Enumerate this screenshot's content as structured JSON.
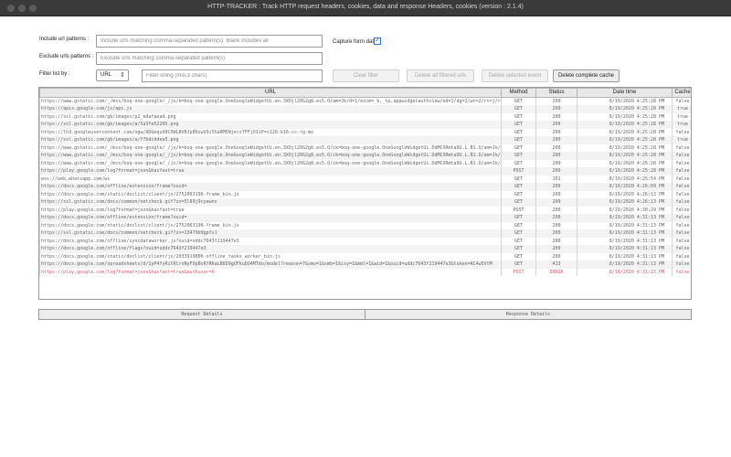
{
  "window": {
    "title": "HTTP-TRACKER : Track HTTP request headers, cookies, data and response Headers, cookies (version : 2.1.4)"
  },
  "form": {
    "include_label": "Include url patterns :",
    "include_placeholder": "Include urls matching comma-separated pattern(s). Blank includes all",
    "exclude_label": "Exclude urls patterns :",
    "exclude_placeholder": "Exclude urls matching comma-separated pattern(s)",
    "capture_label": "Capture form data",
    "capture_checked": true,
    "filter_label": "Filter list by :",
    "filter_select": "URL",
    "filter_placeholder": "Filter string (min 3 chars)"
  },
  "buttons": {
    "clear_filter": "Clear filter",
    "delete_filtered": "Delete all filtered urls",
    "delete_selected": "Delete selected event",
    "delete_cache": "Delete complete cache"
  },
  "table": {
    "columns": [
      "URL",
      "Method",
      "Status",
      "Date time",
      "Cache"
    ],
    "rows": [
      {
        "url": "https://www.gstatic.com/_/mss/boq-one-google/_/js/k=boq-one-google.OneGoogleWidgetUi.en.3X0jl20G2g8.es5.O/am=Jk/d=1/excm=_b,_tp,appwidgetauthview/ed=1/dg=2/wt=2/rt=j/rs=AM-SdHu",
        "method": "GET",
        "status": "200",
        "date": "8/19/2020 4:25:28 PM",
        "cache": "false"
      },
      {
        "url": "https://apis.google.com/js/api.js",
        "method": "GET",
        "status": "200",
        "date": "8/19/2020 4:25:28 PM",
        "cache": "true"
      },
      {
        "url": "https://ssl.gstatic.com/gb/images/p2_edafaead.png",
        "method": "GET",
        "status": "200",
        "date": "8/19/2020 4:25:28 PM",
        "cache": "true"
      },
      {
        "url": "https://ssl.gstatic.com/gb/images/a/5a3fe52205.png",
        "method": "GET",
        "status": "200",
        "date": "8/19/2020 4:25:28 PM",
        "cache": "true"
      },
      {
        "url": "https://lh3.googleusercontent.com/ogw/ADGmqu90COWLBVBJpB0zwV9i5GaRM5Njerz7FFjOIiP=s128-b16-cc-rg-mo",
        "method": "GET",
        "status": "200",
        "date": "8/19/2020 4:25:28 PM",
        "cache": "false"
      },
      {
        "url": "https://ssl.gstatic.com/gb/images/a/f7bdcddea5.png",
        "method": "GET",
        "status": "200",
        "date": "8/19/2020 4:25:28 PM",
        "cache": "true"
      },
      {
        "url": "https://www.gstatic.com/_/mss/boq-one-google/_/js/k=boq-one-google.OneGoogleWidgetUi.en.3X0jl20G2g8.es5.O/ck=boq-one-google.OneGoogleWidgetUi.DdMCXRmta9U.L.B1.O/am=Jk/d=1/e",
        "method": "GET",
        "status": "200",
        "date": "8/19/2020 4:25:28 PM",
        "cache": "false"
      },
      {
        "url": "https://www.gstatic.com/_/mss/boq-one-google/_/js/k=boq-one-google.OneGoogleWidgetUi.en.3X0jl20G2g8.es5.O/ck=boq-one-google.OneGoogleWidgetUi.DdMCXRmta9U.L.B1.O/am=Jk/d=1/e",
        "method": "GET",
        "status": "200",
        "date": "8/19/2020 4:25:28 PM",
        "cache": "false"
      },
      {
        "url": "https://www.gstatic.com/_/mss/boq-one-google/_/js/k=boq-one-google.OneGoogleWidgetUi.en.3X0jl20G2g8.es5.O/ck=boq-one-google.OneGoogleWidgetUi.DdMCXRmta9U.L.B1.O/am=Jk/d=1/e",
        "method": "GET",
        "status": "200",
        "date": "8/19/2020 4:25:28 PM",
        "cache": "false"
      },
      {
        "url": "https://play.google.com/log?format=json&hasfast=true",
        "method": "POST",
        "status": "200",
        "date": "8/19/2020 4:25:28 PM",
        "cache": "false"
      },
      {
        "url": "wss://web.whatsapp.com/ws",
        "method": "GET",
        "status": "101",
        "date": "8/19/2020 4:25:54 PM",
        "cache": "false"
      },
      {
        "url": "https://docs.google.com/offline/extension/frame?ouid=",
        "method": "GET",
        "status": "200",
        "date": "8/19/2020 4:26:09 PM",
        "cache": "false"
      },
      {
        "url": "https://docs.google.com/static/doclist/client/js/2752063196-frame_bin.js",
        "method": "GET",
        "status": "200",
        "date": "8/19/2020 4:26:13 PM",
        "cache": "false"
      },
      {
        "url": "https://ssl.gstatic.com/docs/common/netcheck.gif?zx=5l89j9cyewns",
        "method": "GET",
        "status": "200",
        "date": "8/19/2020 4:26:13 PM",
        "cache": "false"
      },
      {
        "url": "https://play.google.com/log?format=json&hasfast=true",
        "method": "POST",
        "status": "200",
        "date": "8/19/2020 4:30:29 PM",
        "cache": "false"
      },
      {
        "url": "https://docs.google.com/offline/extension/frame?ouid=",
        "method": "GET",
        "status": "200",
        "date": "8/19/2020 4:31:13 PM",
        "cache": "false"
      },
      {
        "url": "https://docs.google.com/static/doclist/client/js/2752063196-frame_bin.js",
        "method": "GET",
        "status": "200",
        "date": "8/19/2020 4:31:13 PM",
        "cache": "false"
      },
      {
        "url": "https://ssl.gstatic.com/docs/common/netcheck.gif?zx=13479b9gpfs1",
        "method": "GET",
        "status": "200",
        "date": "8/19/2020 4:31:13 PM",
        "cache": "false"
      },
      {
        "url": "https://docs.google.com/offline/syncdataworker.js?ouid=uddc7643f219447e3",
        "method": "GET",
        "status": "200",
        "date": "8/19/2020 4:31:13 PM",
        "cache": "false"
      },
      {
        "url": "https://docs.google.com/offline/flags?ouid=uddc7643f219447e3",
        "method": "GET",
        "status": "200",
        "date": "8/19/2020 4:31:13 PM",
        "cache": "false"
      },
      {
        "url": "https://docs.google.com/static/doclist/client/js/2033919806-offline_tasks_worker_bin.js",
        "method": "GET",
        "status": "200",
        "date": "8/19/2020 4:31:13 PM",
        "cache": "false"
      },
      {
        "url": "https://docs.google.com/spreadsheets/d/1yP4fyRitRlrxNyFOpBsRfRKaLB6D9gUFkuDO4MTdo/model?reason=7&smv=1&smb=1&isy=1&mml=1&aid=1&ouid=uddc7643f219447e3&token=AC4w5VtM",
        "method": "GET",
        "status": "413",
        "date": "8/19/2020 4:31:13 PM",
        "cache": "false"
      },
      {
        "url": "https://play.google.com/log?format=json&hasfast=true&authuser=0",
        "method": "POST",
        "status": "ERROR",
        "date": "8/19/2020 4:31:15 PM",
        "cache": "false",
        "error": true
      }
    ]
  },
  "details": {
    "request_label": "Request Details",
    "response_label": "Response Details"
  }
}
